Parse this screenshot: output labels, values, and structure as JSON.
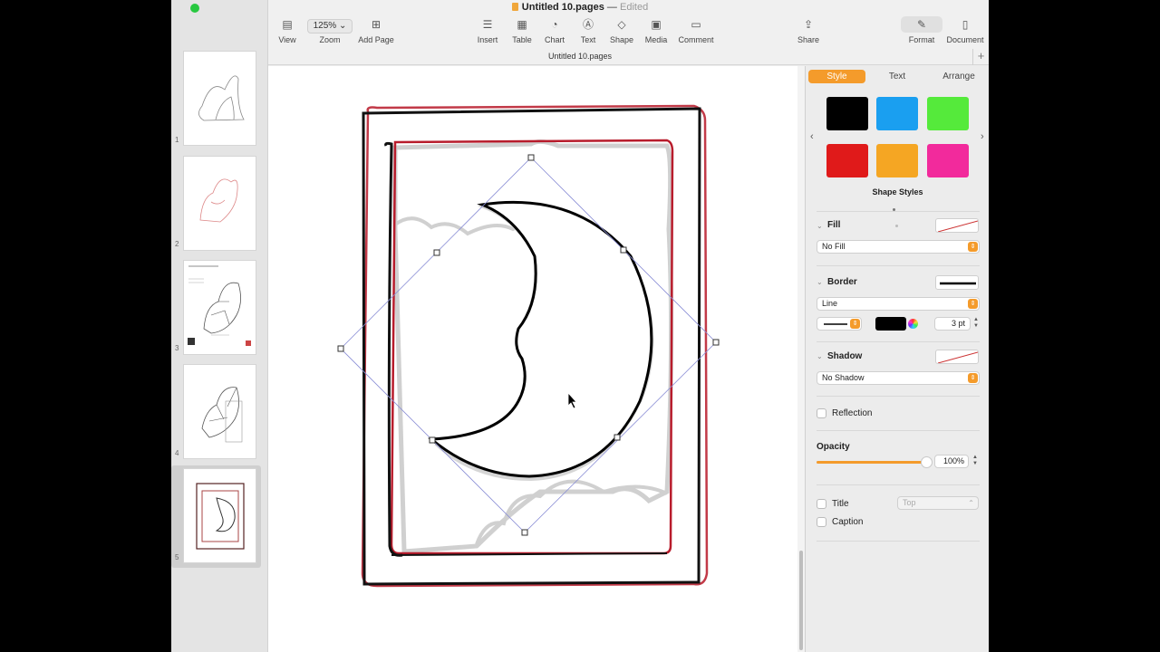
{
  "window": {
    "title": "Untitled 10.pages",
    "status": "Edited",
    "file_tab": "Untitled 10.pages",
    "traffic_colors": [
      "#fd5f57",
      "#febc2e",
      "#28c840"
    ]
  },
  "toolbar": {
    "view": "View",
    "zoom_value": "125%",
    "zoom": "Zoom",
    "add_page": "Add Page",
    "insert": "Insert",
    "table": "Table",
    "chart": "Chart",
    "text": "Text",
    "shape": "Shape",
    "media": "Media",
    "comment": "Comment",
    "share": "Share",
    "format": "Format",
    "document": "Document",
    "add_tab": "+"
  },
  "sidebar": {
    "pages": [
      {
        "number": "1"
      },
      {
        "number": "2"
      },
      {
        "number": "3"
      },
      {
        "number": "4"
      },
      {
        "number": "5",
        "selected": true
      }
    ]
  },
  "inspector": {
    "tabs": {
      "style": "Style",
      "text": "Text",
      "arrange": "Arrange"
    },
    "active_tab": "Style",
    "swatches": [
      "#000000",
      "#1a9ff0",
      "#55ea3b",
      "#e01a1a",
      "#f5a623",
      "#f22a9c"
    ],
    "shape_styles": "Shape Styles",
    "fill": {
      "label": "Fill",
      "value": "No Fill"
    },
    "border": {
      "label": "Border",
      "value": "Line",
      "color": "#000000",
      "width": "3 pt"
    },
    "shadow": {
      "label": "Shadow",
      "value": "No Shadow"
    },
    "reflection": {
      "label": "Reflection"
    },
    "opacity": {
      "label": "Opacity",
      "value": "100%",
      "level": 1.0
    },
    "title": {
      "label": "Title",
      "position": "Top"
    },
    "caption": {
      "label": "Caption"
    },
    "accent": "#f49b2b"
  }
}
